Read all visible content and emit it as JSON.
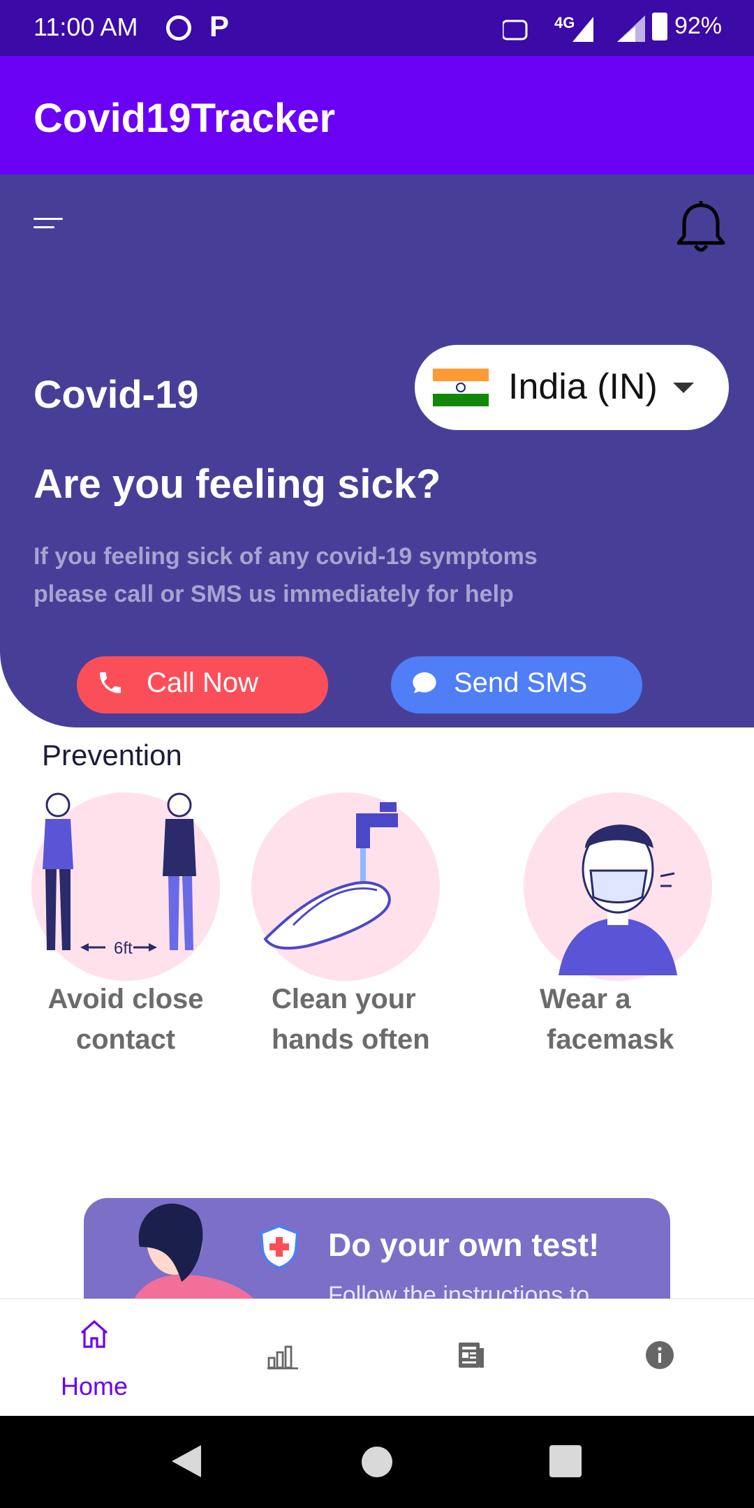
{
  "status_bar": {
    "time": "11:00 AM",
    "battery": "92%",
    "network": "4G"
  },
  "app_bar": {
    "title": "Covid19Tracker"
  },
  "hero": {
    "title": "Covid-19",
    "country_selector": {
      "value": "India (IN)"
    },
    "headline": "Are you feeling sick?",
    "description": "If you feeling sick of any covid-19 symptoms please call or SMS us immediately for help",
    "call_button": "Call Now",
    "sms_button": "Send SMS"
  },
  "prevention": {
    "title": "Prevention",
    "items": [
      {
        "label_line1": "Avoid close",
        "label_line2": "contact",
        "illustration": "6ft"
      },
      {
        "label_line1": "Clean your",
        "label_line2": "hands often"
      },
      {
        "label_line1": "Wear a",
        "label_line2": "facemask"
      }
    ]
  },
  "banner": {
    "title": "Do your own test!",
    "subtitle": "Follow the instructions to"
  },
  "bottom_nav": {
    "items": [
      {
        "label": "Home",
        "icon": "home-icon",
        "active": true
      },
      {
        "label": "",
        "icon": "chart-icon",
        "active": false
      },
      {
        "label": "",
        "icon": "news-icon",
        "active": false
      },
      {
        "label": "",
        "icon": "info-icon",
        "active": false
      }
    ]
  },
  "colors": {
    "status_bar": "#3c0aa6",
    "app_bar": "#6a00f4",
    "hero": "#473f97",
    "call": "#fa4f59",
    "sms": "#4f7ef7",
    "active_nav": "#6a00f4"
  }
}
